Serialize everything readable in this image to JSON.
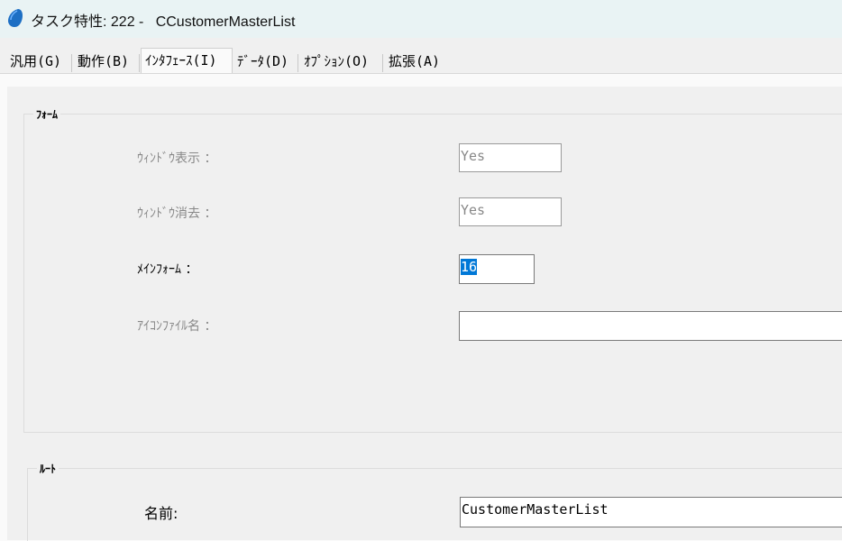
{
  "window": {
    "title": "タスク特性: 222 -   CCustomerMasterList"
  },
  "tabs": [
    {
      "label": "汎用(G)"
    },
    {
      "label": "動作(B)"
    },
    {
      "label": "ｲﾝﾀﾌｪｰｽ(I)",
      "active": true
    },
    {
      "label": "ﾃﾞｰﾀ(D)"
    },
    {
      "label": "ｵﾌﾟｼｮﾝ(O)"
    },
    {
      "label": "拡張(A)"
    }
  ],
  "form_group": {
    "title": "ﾌｫｰﾑ",
    "window_open": {
      "label": "ｳｨﾝﾄﾞｳ表示 ：",
      "value": "Yes"
    },
    "window_close": {
      "label": "ｳｨﾝﾄﾞｳ消去 ：",
      "value": "Yes"
    },
    "main_form": {
      "label": "ﾒｲﾝﾌｫｰﾑ ：",
      "value": "16"
    },
    "icon_file": {
      "label": "ｱｲｺﾝﾌｧｲﾙ名 ：",
      "value": ""
    }
  },
  "route_group": {
    "title": "ﾙｰﾄ",
    "name": {
      "label": "名前:",
      "value": "CustomerMasterList"
    }
  },
  "colors": {
    "selection": "#0078d7",
    "titlebar": "#e9f3f4"
  },
  "icons": {
    "app": "app-icon"
  }
}
